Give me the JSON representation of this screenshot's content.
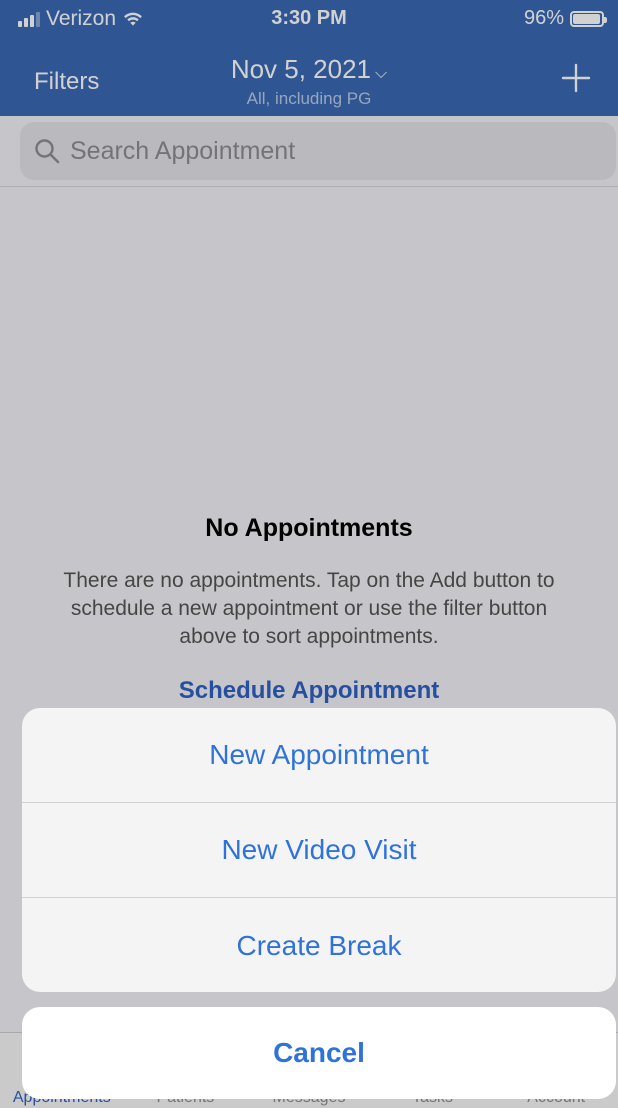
{
  "status_bar": {
    "carrier": "Verizon",
    "time": "3:30 PM",
    "battery": "96%",
    "battery_level": 0.96
  },
  "nav": {
    "filters_label": "Filters",
    "date": "Nov 5, 2021",
    "chevron": "⌵",
    "subtitle": "All, including PG",
    "add_icon": "plus-icon"
  },
  "search": {
    "placeholder": "Search Appointment",
    "icon": "search-icon"
  },
  "empty_state": {
    "title": "No Appointments",
    "message": "There are no appointments. Tap on the Add button to schedule a new appointment or use the filter button above to sort appointments.",
    "link": "Schedule Appointment"
  },
  "tab_bar": {
    "items": [
      {
        "label": "Appointments",
        "active": true
      },
      {
        "label": "Patients",
        "active": false
      },
      {
        "label": "Messages",
        "active": false
      },
      {
        "label": "Tasks",
        "active": false
      },
      {
        "label": "Account",
        "active": false
      }
    ]
  },
  "action_sheet": {
    "items": [
      {
        "label": "New Appointment"
      },
      {
        "label": "New Video Visit"
      },
      {
        "label": "Create Break"
      }
    ],
    "cancel_label": "Cancel"
  },
  "colors": {
    "header": "#3a6ab4",
    "accent": "#2f73d9",
    "background": "#f2f2f7"
  }
}
